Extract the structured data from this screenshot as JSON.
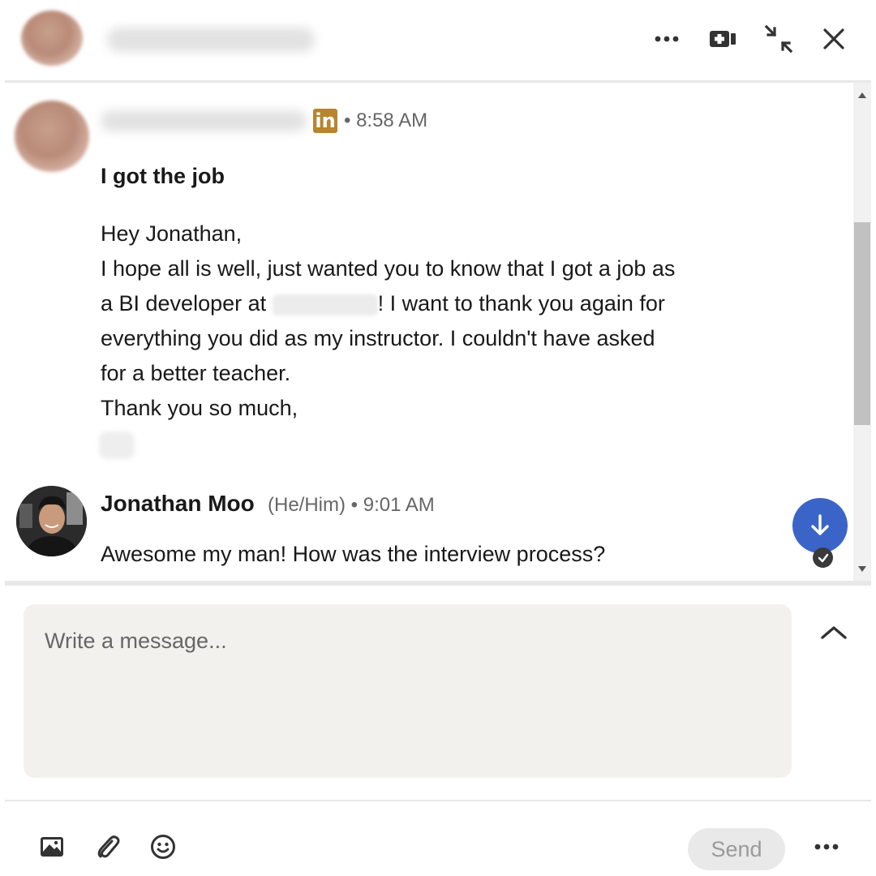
{
  "header": {
    "more_icon": "more-horizontal-icon",
    "video_icon": "video-call-icon",
    "minimize_icon": "collapse-window-icon",
    "close_icon": "close-icon"
  },
  "messages": [
    {
      "badge": "in",
      "time": "• 8:58 AM",
      "subject": "I got the job",
      "lines": [
        "Hey Jonathan,",
        "I hope all is well, just wanted you to know that I got a job as",
        "a BI developer at",
        "! I want to thank you again for",
        "everything you did as my instructor. I couldn't have asked",
        "for a better teacher.",
        "Thank you so much,"
      ]
    },
    {
      "sender": "Jonathan Moo",
      "pronouns_time": "(He/Him) • 9:01 AM",
      "text": "Awesome my man! How was the interview process?"
    }
  ],
  "composer": {
    "placeholder": "Write a message..."
  },
  "footer": {
    "send_label": "Send",
    "icons": [
      "image-icon",
      "attachment-icon",
      "emoji-icon",
      "more-horizontal-icon"
    ]
  },
  "colors": {
    "linkedin_badge": "#b6852f",
    "jump_button": "#3b64c9",
    "composer_bg": "#f2f1ee"
  }
}
